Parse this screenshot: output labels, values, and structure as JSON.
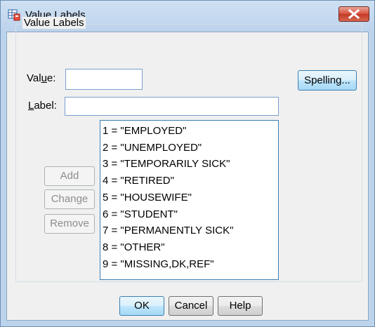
{
  "window": {
    "title": "Value Labels",
    "icon": "value-labels-icon",
    "close_icon": "close-x-icon"
  },
  "group": {
    "legend": "Value Labels"
  },
  "fields": {
    "value_label_pre": "Val",
    "value_label_mnemonic": "u",
    "value_label_post": "e:",
    "value_input": "",
    "label_label_mnemonic": "L",
    "label_label_post": "abel:",
    "label_input": ""
  },
  "buttons": {
    "spelling": "Spelling...",
    "add": "Add",
    "change": "Change",
    "remove": "Remove",
    "ok": "OK",
    "cancel": "Cancel",
    "help": "Help"
  },
  "value_labels": [
    "1 = \"EMPLOYED\"",
    "2 = \"UNEMPLOYED\"",
    "3 = \"TEMPORARILY SICK\"",
    "4 = \"RETIRED\"",
    "5 = \"HOUSEWIFE\"",
    "6 = \"STUDENT\"",
    "7 = \"PERMANENTLY SICK\"",
    "8 = \"OTHER\"",
    "9 = \"MISSING,DK,REF\""
  ],
  "colors": {
    "frame": "#bcd3ec",
    "client": "#f0f0f0",
    "close_button": "#c94531",
    "focus_border": "#3c7fb1"
  }
}
